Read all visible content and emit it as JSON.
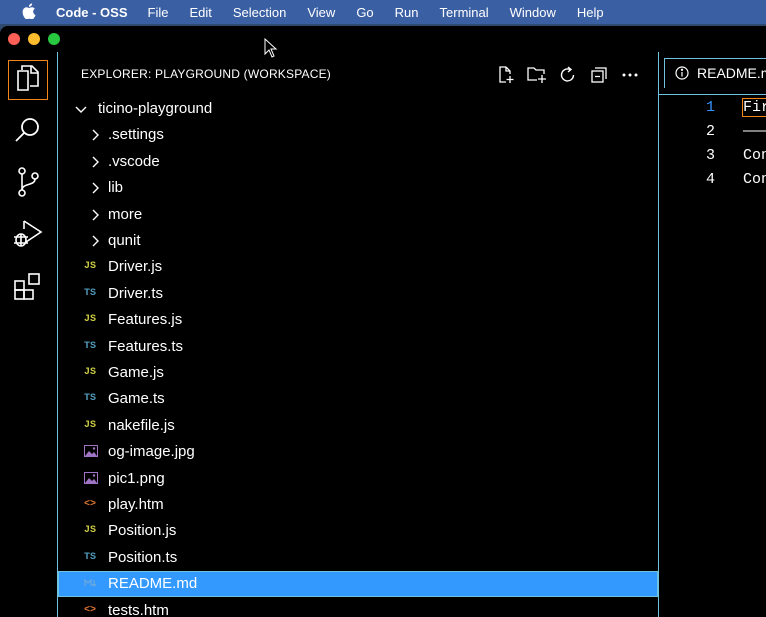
{
  "menubar": {
    "app": "Code - OSS",
    "items": [
      "File",
      "Edit",
      "Selection",
      "View",
      "Go",
      "Run",
      "Terminal",
      "Window",
      "Help"
    ]
  },
  "activity_bar": {
    "items": [
      {
        "name": "explorer-icon",
        "active": true
      },
      {
        "name": "search-icon",
        "active": false
      },
      {
        "name": "source-control-icon",
        "active": false
      },
      {
        "name": "run-debug-icon",
        "active": false
      },
      {
        "name": "extensions-icon",
        "active": false
      }
    ]
  },
  "sidebar": {
    "title": "EXPLORER: PLAYGROUND (WORKSPACE)",
    "actions": [
      "new-file-icon",
      "new-folder-icon",
      "refresh-icon",
      "collapse-all-icon",
      "more-actions-icon"
    ],
    "root": {
      "label": "ticino-playground",
      "expanded": true
    },
    "items": [
      {
        "label": ".settings",
        "kind": "folder"
      },
      {
        "label": ".vscode",
        "kind": "folder"
      },
      {
        "label": "lib",
        "kind": "folder"
      },
      {
        "label": "more",
        "kind": "folder"
      },
      {
        "label": "qunit",
        "kind": "folder"
      },
      {
        "label": "Driver.js",
        "kind": "js",
        "badge": "JS"
      },
      {
        "label": "Driver.ts",
        "kind": "ts",
        "badge": "TS"
      },
      {
        "label": "Features.js",
        "kind": "js",
        "badge": "JS"
      },
      {
        "label": "Features.ts",
        "kind": "ts",
        "badge": "TS"
      },
      {
        "label": "Game.js",
        "kind": "js",
        "badge": "JS"
      },
      {
        "label": "Game.ts",
        "kind": "ts",
        "badge": "TS"
      },
      {
        "label": "nakefile.js",
        "kind": "js",
        "badge": "JS"
      },
      {
        "label": "og-image.jpg",
        "kind": "image"
      },
      {
        "label": "pic1.png",
        "kind": "image"
      },
      {
        "label": "play.htm",
        "kind": "html",
        "badge": "<>"
      },
      {
        "label": "Position.js",
        "kind": "js",
        "badge": "JS"
      },
      {
        "label": "Position.ts",
        "kind": "ts",
        "badge": "TS"
      },
      {
        "label": "README.md",
        "kind": "md",
        "selected": true
      },
      {
        "label": "tests.htm",
        "kind": "html",
        "badge": "<>"
      }
    ]
  },
  "editor": {
    "tab_label": "README.md",
    "lines": [
      {
        "num": "1",
        "text": "Fir",
        "current": true
      },
      {
        "num": "2",
        "text": "———",
        "current": false
      },
      {
        "num": "3",
        "text": "Con",
        "current": false
      },
      {
        "num": "4",
        "text": "Con",
        "current": false
      }
    ]
  },
  "colors": {
    "js": "#cbcb41",
    "ts": "#519aba",
    "html": "#e37933",
    "image": "#a074c4",
    "selection": "#3399ff",
    "contrast_border": "#6fc3df",
    "focus_border": "#f38518"
  }
}
